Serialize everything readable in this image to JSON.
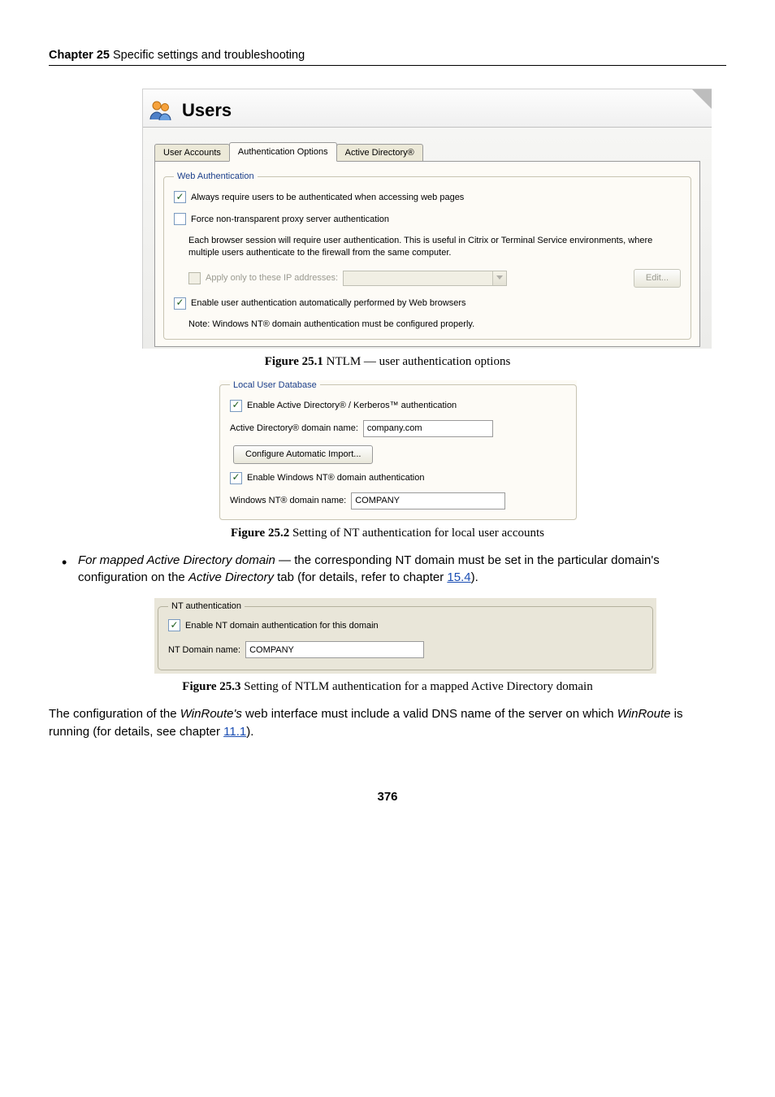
{
  "chapter": {
    "label_bold": "Chapter 25",
    "label_rest": "  Specific settings and troubleshooting"
  },
  "panel1": {
    "title": "Users",
    "tabs": [
      "User Accounts",
      "Authentication Options",
      "Active Directory®"
    ],
    "active_tab_index": 1,
    "web_auth": {
      "legend": "Web Authentication",
      "always_require": "Always require users to be authenticated when accessing web pages",
      "force_nontrans": "Force non-transparent proxy server authentication",
      "desc": "Each browser session will require user authentication. This is useful in Citrix or Terminal Service environments, where multiple users authenticate to the firewall from the same computer.",
      "apply_only": "Apply only to these IP addresses:",
      "edit": "Edit...",
      "enable_auto": "Enable user authentication automatically performed by Web browsers",
      "note": "Note: Windows NT® domain authentication must be configured properly."
    }
  },
  "figcap1": {
    "bold": "Figure 25.1",
    "rest": "   NTLM — user authentication options"
  },
  "panel2": {
    "legend": "Local User Database",
    "enable_ad": "Enable Active Directory® / Kerberos™ authentication",
    "ad_label": "Active Directory® domain name:",
    "ad_value": "company.com",
    "config_btn": "Configure Automatic Import...",
    "enable_nt": "Enable Windows NT® domain authentication",
    "nt_label": "Windows NT® domain name:",
    "nt_value": "COMPANY"
  },
  "figcap2": {
    "bold": "Figure 25.2",
    "rest": "   Setting of NT authentication for local user accounts"
  },
  "bullet": {
    "italic": "For mapped Active Directory domain",
    "rest1": " — the corresponding NT domain must be set in the particular domain's configuration on the ",
    "italic2": "Active Directory",
    "rest2": " tab (for details, refer to chapter ",
    "ref": "15.4",
    "rest3": ")."
  },
  "panel3": {
    "legend": "NT authentication",
    "enable": "Enable NT domain authentication for this domain",
    "nt_label": "NT Domain name:",
    "nt_value": "COMPANY"
  },
  "figcap3": {
    "bold": "Figure 25.3",
    "rest": "   Setting of NTLM authentication for a mapped Active Directory domain"
  },
  "paragraph": {
    "t1": "The configuration of the ",
    "i1": "WinRoute's",
    "t2": " web interface must include a valid DNS name of the server on which ",
    "i2": "WinRoute",
    "t3": " is running (for details, see chapter ",
    "ref": "11.1",
    "t4": ")."
  },
  "page_number": "376"
}
